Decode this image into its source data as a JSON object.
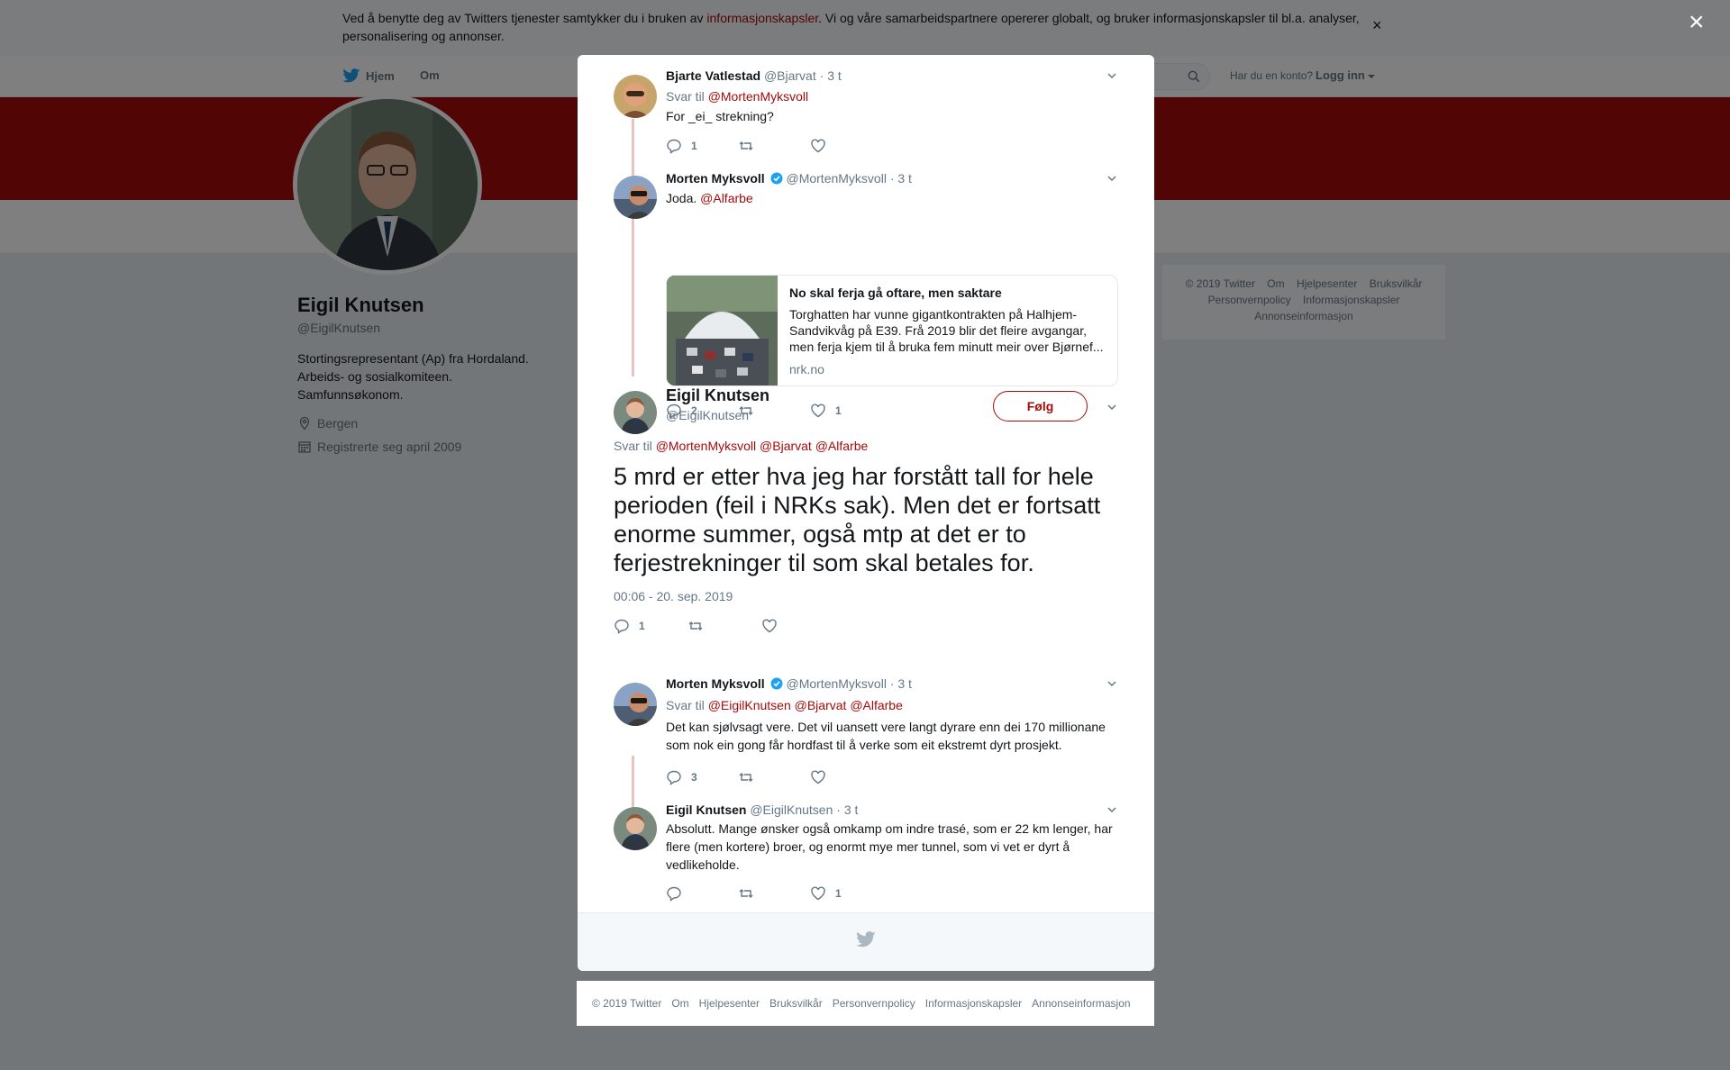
{
  "cookie": {
    "text_before": "Ved å benytte deg av Twitters tjenester samtykker du i bruken av ",
    "link": "informasjonskapsler",
    "text_after": ". Vi og våre samarbeidspartnere opererer globalt, og bruker informasjonskapsler til bl.a. analyser, personalisering og annonser.",
    "close": "×"
  },
  "nav": {
    "home": "Hjem",
    "about": "Om",
    "login_question": "Har du en konto?",
    "login": "Logg inn"
  },
  "profile": {
    "name": "Eigil Knutsen",
    "handle": "@EigilKnutsen",
    "bio_lines": [
      "Stortingsrepresentant (Ap) fra Hordaland.",
      "Arbeids- og sosialkomiteen.",
      "Samfunnsøkonom."
    ],
    "location": "Bergen",
    "joined": "Registrerte seg april 2009"
  },
  "side_footer": [
    "© 2019 Twitter",
    "Om",
    "Hjelpesenter",
    "Bruksvilkår",
    "Personvernpolicy",
    "Informasjonskapsler",
    "Annonseinformasjon"
  ],
  "overlay_close": "×",
  "tweets": [
    {
      "name": "Bjarte Vatlestad",
      "handle": "@Bjarvat",
      "time": "· 3 t",
      "reply_label": "Svar til",
      "reply_to": "@MortenMyksvoll",
      "text": "For _ei_ strekning?",
      "replies": "1",
      "retweets": "",
      "likes": ""
    },
    {
      "name": "Morten Myksvoll",
      "handle": "@MortenMyksvoll",
      "time": "· 3 t",
      "text": "Joda.",
      "mention": "@Alfarbe",
      "card": {
        "title": "No skal ferja gå oftare, men saktare",
        "description": "Torghatten har vunne gigantkontrakten på Halhjem-Sandvikvåg på E39. Frå 2019 blir det fleire avgangar, men ferja kjem til å bruka fem minutt meir over Bjørnef...",
        "domain": "nrk.no"
      },
      "replies": "2",
      "retweets": "",
      "likes": "1"
    },
    {
      "name": "Morten Myksvoll",
      "handle": "@MortenMyksvoll",
      "time": "· 3 t",
      "reply_label": "Svar til",
      "reply_to": [
        "@EigilKnutsen",
        "@Bjarvat",
        "@Alfarbe"
      ],
      "text": "Det kan sjølvsagt vere. Det vil uansett vere langt dyrare enn dei 170 millionane som nok ein gong får hordfast til å verke som eit ekstremt dyrt prosjekt.",
      "replies": "3",
      "retweets": "",
      "likes": ""
    },
    {
      "name": "Eigil Knutsen",
      "handle": "@EigilKnutsen",
      "time": "· 3 t",
      "text": "Absolutt. Mange ønsker også omkamp om indre trasé, som er 22 km lenger, har flere (men kortere) broer, og enormt mye mer tunnel, som vi vet er dyrt å vedlikeholde.",
      "replies": "",
      "retweets": "",
      "likes": "1"
    }
  ],
  "main_tweet": {
    "name": "Eigil Knutsen",
    "handle": "@EigilKnutsen",
    "follow": "Følg",
    "reply_label": "Svar til",
    "reply_to": [
      "@MortenMyksvoll",
      "@Bjarvat",
      "@Alfarbe"
    ],
    "text": "5 mrd er etter hva jeg har forstått tall for hele perioden (feil i NRKs sak). Men det er fortsatt enorme summer, også mtp at det er to ferjestrekninger til som skal betales for.",
    "date": "00:06 - 20. sep. 2019",
    "replies": "1",
    "retweets": "",
    "likes": ""
  },
  "page_footer": [
    "© 2019 Twitter",
    "Om",
    "Hjelpesenter",
    "Bruksvilkår",
    "Personvernpolicy",
    "Informasjonskapsler",
    "Annonseinformasjon"
  ],
  "colors": {
    "accent": "#a50b0b",
    "background": "#e6ecf0",
    "muted_text": "#657786",
    "verified": "#1da1f2"
  },
  "icons": [
    "twitter-bird-icon",
    "search-icon",
    "location-icon",
    "calendar-icon",
    "reply-icon",
    "retweet-icon",
    "like-icon",
    "chevron-down-icon",
    "verified-icon",
    "close-icon"
  ]
}
